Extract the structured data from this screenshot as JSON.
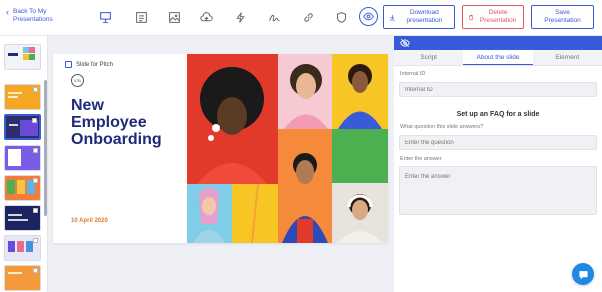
{
  "header": {
    "back_label": "Back To My Presentations",
    "download_label": "Download presentation",
    "delete_label": "Delete Presentation",
    "save_label": "Save Presentation",
    "tools": [
      "presentation-icon",
      "layout-icon",
      "image-icon",
      "cloud-icon",
      "bolt-icon",
      "signature-icon",
      "link-icon",
      "shield-icon"
    ]
  },
  "slide": {
    "slide_for_pitch_label": "Slide for Pitch",
    "logo_text": "ICB",
    "title": "New Employee Onboarding",
    "date": "10 April 2020"
  },
  "panel": {
    "tabs": [
      "Script",
      "About the slide",
      "Element"
    ],
    "active_tab": "About the slide",
    "internal_id_label": "Internal ID",
    "internal_id_placeholder": "Internal ID",
    "faq_title": "Set up an FAQ for a slide",
    "question_label": "What question this slide answers?",
    "question_placeholder": "Enter the question",
    "answer_label": "Enter the answer",
    "answer_placeholder": "Enter the answer"
  },
  "colors": {
    "accent": "#3a5bd9",
    "danger": "#e05560",
    "title": "#1f2a78",
    "date": "#e07a2a"
  }
}
